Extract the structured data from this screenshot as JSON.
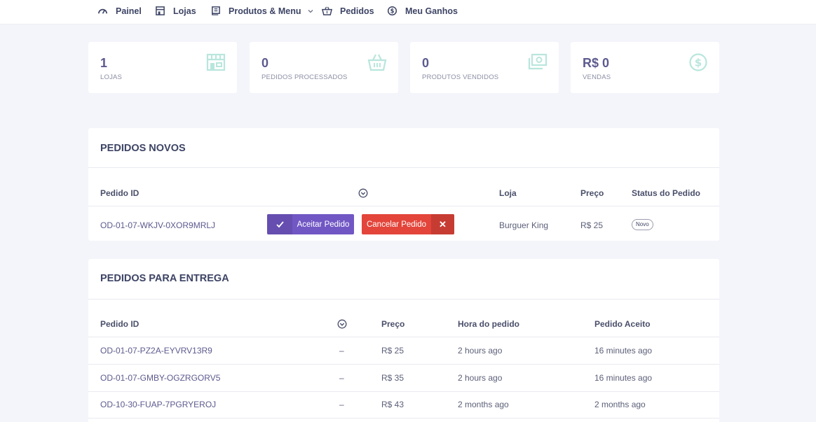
{
  "nav": {
    "items": [
      {
        "label": "Painel",
        "icon": "gauge-icon"
      },
      {
        "label": "Lojas",
        "icon": "store-icon"
      },
      {
        "label": "Produtos & Menu",
        "icon": "menu-book-icon"
      },
      {
        "label": "Pedidos",
        "icon": "basket-icon"
      },
      {
        "label": "Meu Ganhos",
        "icon": "dollar-circle-icon"
      }
    ]
  },
  "stats": [
    {
      "value": "1",
      "label": "LOJAS",
      "icon": "store-icon"
    },
    {
      "value": "0",
      "label": "PEDIDOS PROCESSADOS",
      "icon": "basket-icon"
    },
    {
      "value": "0",
      "label": "PRODUTOS VENDIDOS",
      "icon": "money-icon"
    },
    {
      "value": "R$ 0",
      "label": "VENDAS",
      "icon": "dollar-circle-icon"
    }
  ],
  "new_orders": {
    "title": "PEDIDOS NOVOS",
    "headers": {
      "id": "Pedido ID",
      "store": "Loja",
      "price": "Preço",
      "status": "Status do Pedido"
    },
    "rows": [
      {
        "id": "OD-01-07-WKJV-0XOR9MRLJ",
        "accept": "Aceitar Pedido",
        "cancel": "Cancelar Pedido",
        "store": "Burguer King",
        "price": "R$ 25",
        "status": "Novo"
      }
    ]
  },
  "delivery_orders": {
    "title": "PEDIDOS PARA ENTREGA",
    "headers": {
      "id": "Pedido ID",
      "price": "Preço",
      "order_time": "Hora do pedido",
      "accepted": "Pedido Aceito"
    },
    "rows": [
      {
        "id": "OD-01-07-PZ2A-EYVRV13R9",
        "dash": "–",
        "price": "R$ 25",
        "order_time": "2 hours ago",
        "accepted": "16 minutes ago"
      },
      {
        "id": "OD-01-07-GMBY-OGZRGORV5",
        "dash": "–",
        "price": "R$ 35",
        "order_time": "2 hours ago",
        "accepted": "16 minutes ago"
      },
      {
        "id": "OD-10-30-FUAP-7PGRYEROJ",
        "dash": "–",
        "price": "R$ 43",
        "order_time": "2 months ago",
        "accepted": "2 months ago"
      }
    ]
  },
  "colors": {
    "accent": "#7157c4",
    "danger": "#e3453a",
    "stat_icon": "#b9e6dc"
  }
}
